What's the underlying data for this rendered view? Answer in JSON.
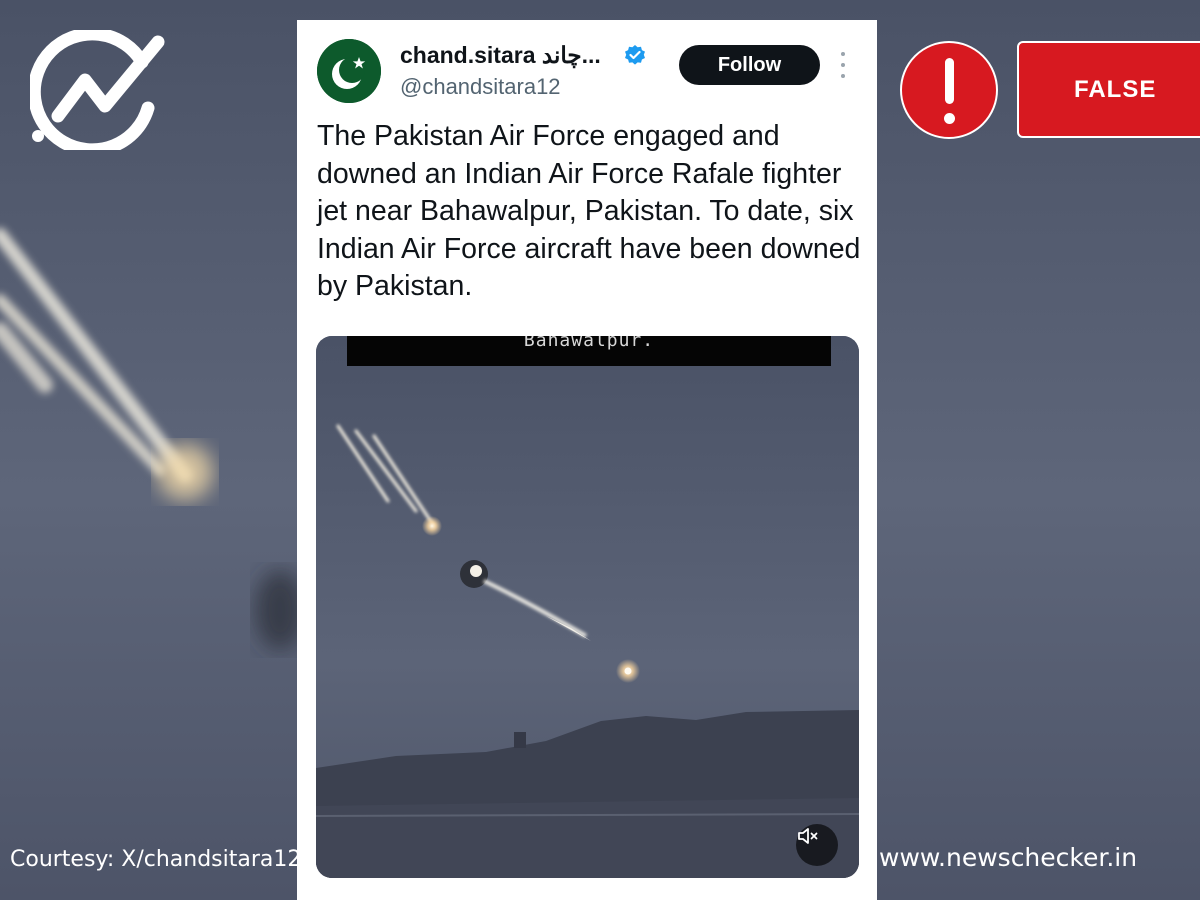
{
  "branding": {
    "logo_icon": "newschecker-checkmark-logo-icon",
    "website": "www.newschecker.in",
    "courtesy": "Courtesy: X/chandsitara12"
  },
  "tweet": {
    "display_name": "chand.sitara چاند...",
    "handle": "@chandsitara12",
    "verified_icon": "verified-badge-icon",
    "avatar_icon": "pakistan-flag-crescent-star-icon",
    "follow_label": "Follow",
    "more_icon": "more-options-icon",
    "text": "The Pakistan Air Force engaged and downed an Indian Air Force Rafale fighter jet near Bahawalpur, Pakistan.  To date, six Indian Air Force aircraft have been downed by Pakistan.",
    "media": {
      "caption": "Bahawalpur.",
      "mute_icon": "muted-speaker-icon"
    }
  },
  "verdict": {
    "icon": "exclamation-alert-icon",
    "label": "FALSE"
  },
  "colors": {
    "verdict_red": "#d71920",
    "follow_button": "#0f1419",
    "verified_blue": "#1d9bf0",
    "avatar_green": "#0d5a2c"
  }
}
